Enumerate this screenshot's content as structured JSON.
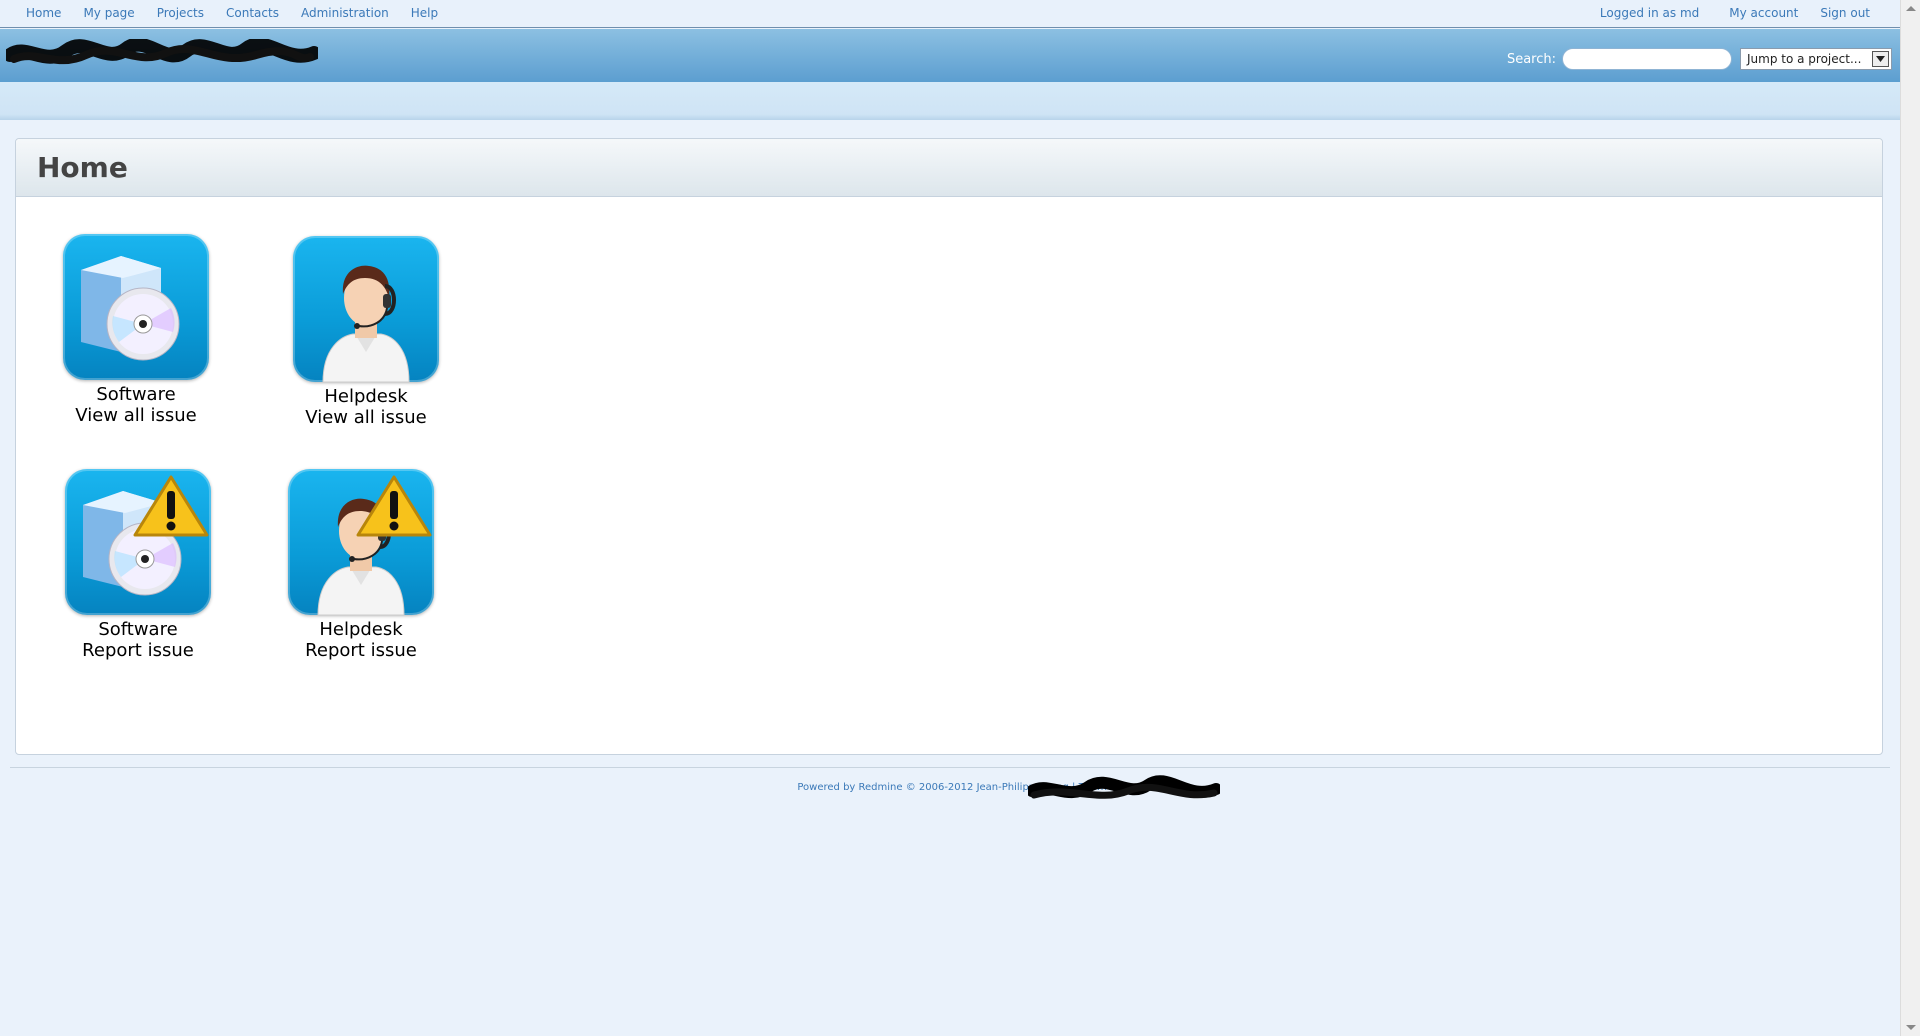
{
  "top_menu": {
    "left_items": [
      "Home",
      "My page",
      "Projects",
      "Contacts",
      "Administration",
      "Help"
    ],
    "logged_as": "Logged in as md",
    "my_account": "My account",
    "sign_out": "Sign out"
  },
  "header": {
    "search_label": "Search:",
    "search_value": "",
    "project_jump": "Jump to a project..."
  },
  "content": {
    "title": "Home",
    "tiles": [
      {
        "line1": "Software",
        "line2": "View all issue",
        "icon": "software-box-icon"
      },
      {
        "line1": "Helpdesk",
        "line2": "View all issue",
        "icon": "helpdesk-operator-icon"
      },
      {
        "line1": "Software",
        "line2": "Report issue",
        "icon": "software-box-warning-icon"
      },
      {
        "line1": "Helpdesk",
        "line2": "Report issue",
        "icon": "helpdesk-operator-warning-icon"
      }
    ]
  },
  "footer": {
    "text": "Powered by Redmine © 2006-2012 Jean-Philippe Lang | Theme b"
  },
  "colors": {
    "link": "#3b79b8",
    "header_top": "#8cc0e2",
    "header_bottom": "#5c9ed0",
    "tile_blue": "#0a9bd7"
  }
}
